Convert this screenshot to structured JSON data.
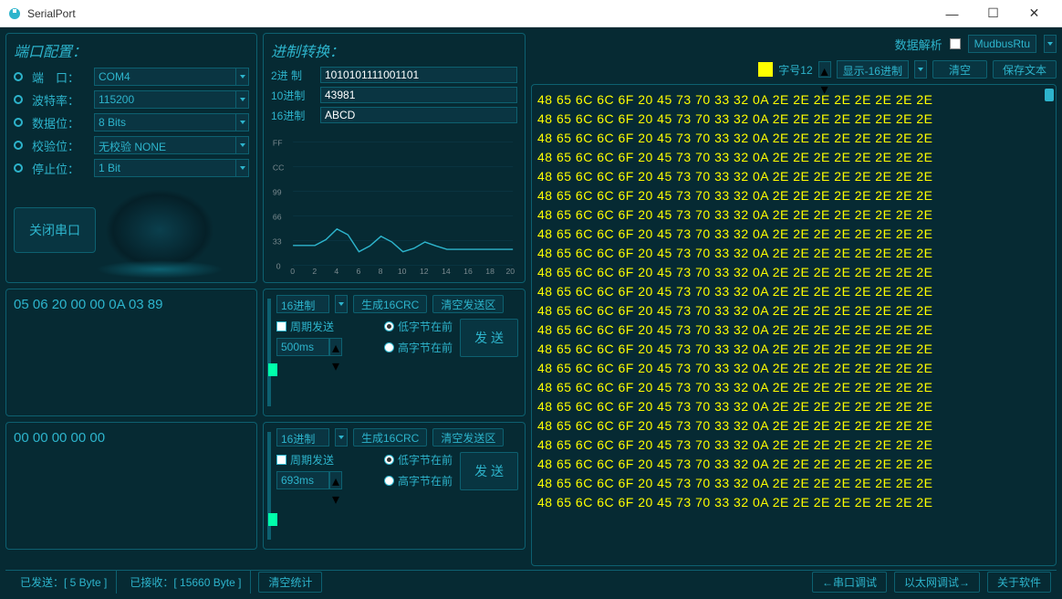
{
  "window": {
    "title": "SerialPort"
  },
  "port_config": {
    "title": "端口配置：",
    "port_label": "端　口：",
    "port_value": "COM4",
    "baud_label": "波特率：",
    "baud_value": "115200",
    "data_label": "数据位：",
    "data_value": "8 Bits",
    "parity_label": "校验位：",
    "parity_value": "无校验 NONE",
    "stop_label": "停止位：",
    "stop_value": "1 Bit",
    "close_btn": "关闭串口"
  },
  "convert": {
    "title": "进制转换：",
    "bin_label": "2进  制",
    "bin_value": "1010101111001101",
    "dec_label": "10进制",
    "dec_value": "43981",
    "hex_label": "16进制",
    "hex_value": "ABCD"
  },
  "chart_data": {
    "type": "line",
    "x": [
      0,
      1,
      2,
      3,
      4,
      5,
      6,
      7,
      8,
      9,
      10,
      11,
      12,
      13,
      14,
      15,
      16,
      17,
      18,
      19,
      20
    ],
    "values": [
      41,
      41,
      41,
      53,
      75,
      63,
      28,
      40,
      60,
      48,
      28,
      35,
      48,
      40,
      33,
      33,
      33,
      33,
      33,
      33,
      33
    ],
    "y_ticks": [
      "FF",
      "CC",
      "99",
      "66",
      "33",
      "0"
    ],
    "x_ticks": [
      "0",
      "2",
      "4",
      "6",
      "8",
      "10",
      "12",
      "14",
      "16",
      "18",
      "20"
    ],
    "title": "",
    "xlabel": "",
    "ylabel": ""
  },
  "hex_box1": "05 06 20 00 00 0A 03 89",
  "hex_box2": "00 00 00 00 00",
  "send1": {
    "format": "16进制",
    "gen_crc": "生成16CRC",
    "clear_send": "清空发送区",
    "periodic": "周期发送",
    "period": "500ms",
    "low_byte": "低字节在前",
    "high_byte": "高字节在前",
    "send": "发  送"
  },
  "send2": {
    "format": "16进制",
    "gen_crc": "生成16CRC",
    "clear_send": "清空发送区",
    "periodic": "周期发送",
    "period": "693ms",
    "low_byte": "低字节在前",
    "high_byte": "高字节在前",
    "send": "发  送"
  },
  "right": {
    "data_parse": "数据解析",
    "modbus": "MudbusRtu",
    "font_label": "字号12",
    "display_label": "显示-16进制",
    "clear_btn": "清空",
    "save_btn": "保存文本"
  },
  "data_lines": [
    "48 65 6C 6C 6F 20 45 73 70 33 32 0A 2E 2E 2E 2E 2E 2E 2E 2E",
    "48 65 6C 6C 6F 20 45 73 70 33 32 0A 2E 2E 2E 2E 2E 2E 2E 2E",
    "48 65 6C 6C 6F 20 45 73 70 33 32 0A 2E 2E 2E 2E 2E 2E 2E 2E",
    "48 65 6C 6C 6F 20 45 73 70 33 32 0A 2E 2E 2E 2E 2E 2E 2E 2E",
    "48 65 6C 6C 6F 20 45 73 70 33 32 0A 2E 2E 2E 2E 2E 2E 2E 2E",
    "48 65 6C 6C 6F 20 45 73 70 33 32 0A 2E 2E 2E 2E 2E 2E 2E 2E",
    "48 65 6C 6C 6F 20 45 73 70 33 32 0A 2E 2E 2E 2E 2E 2E 2E 2E",
    "48 65 6C 6C 6F 20 45 73 70 33 32 0A 2E 2E 2E 2E 2E 2E 2E 2E",
    "48 65 6C 6C 6F 20 45 73 70 33 32 0A 2E 2E 2E 2E 2E 2E 2E 2E",
    "48 65 6C 6C 6F 20 45 73 70 33 32 0A 2E 2E 2E 2E 2E 2E 2E 2E",
    "48 65 6C 6C 6F 20 45 73 70 33 32 0A 2E 2E 2E 2E 2E 2E 2E 2E",
    "48 65 6C 6C 6F 20 45 73 70 33 32 0A 2E 2E 2E 2E 2E 2E 2E 2E",
    "48 65 6C 6C 6F 20 45 73 70 33 32 0A 2E 2E 2E 2E 2E 2E 2E 2E",
    "48 65 6C 6C 6F 20 45 73 70 33 32 0A 2E 2E 2E 2E 2E 2E 2E 2E",
    "48 65 6C 6C 6F 20 45 73 70 33 32 0A 2E 2E 2E 2E 2E 2E 2E 2E",
    "48 65 6C 6C 6F 20 45 73 70 33 32 0A 2E 2E 2E 2E 2E 2E 2E 2E",
    "48 65 6C 6C 6F 20 45 73 70 33 32 0A 2E 2E 2E 2E 2E 2E 2E 2E",
    "48 65 6C 6C 6F 20 45 73 70 33 32 0A 2E 2E 2E 2E 2E 2E 2E 2E",
    "48 65 6C 6C 6F 20 45 73 70 33 32 0A 2E 2E 2E 2E 2E 2E 2E 2E",
    "48 65 6C 6C 6F 20 45 73 70 33 32 0A 2E 2E 2E 2E 2E 2E 2E 2E",
    "48 65 6C 6C 6F 20 45 73 70 33 32 0A 2E 2E 2E 2E 2E 2E 2E 2E",
    "48 65 6C 6C 6F 20 45 73 70 33 32 0A 2E 2E 2E 2E 2E 2E 2E 2E"
  ],
  "status": {
    "sent": "已发送：[  5 Byte  ]",
    "recv": "已接收：[  15660 Byte  ]",
    "clear_stats": "清空统计",
    "serial_debug": "←串口调试",
    "ethernet_debug": "以太网调试→",
    "about": "关于软件"
  }
}
